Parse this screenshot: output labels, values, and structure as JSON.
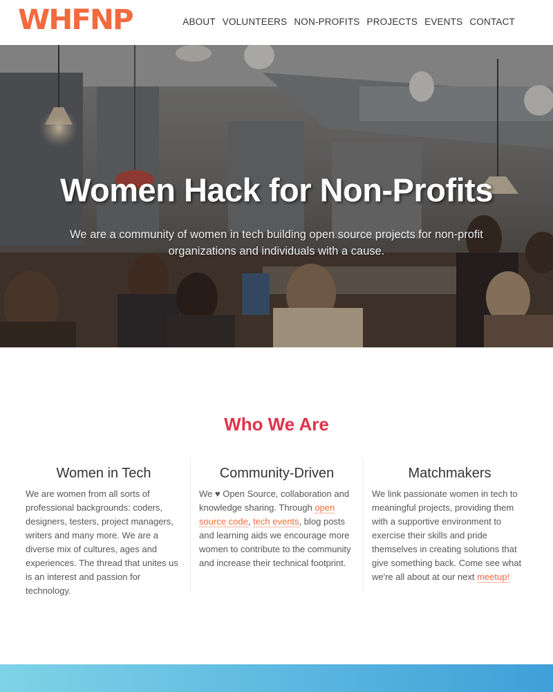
{
  "header": {
    "logo_text": "WHFNP",
    "nav": [
      "ABOUT",
      "VOLUNTEERS",
      "NON-PROFITS",
      "PROJECTS",
      "EVENTS",
      "CONTACT"
    ]
  },
  "hero": {
    "title": "Women Hack for Non-Profits",
    "subtitle": "We are a community of women in tech building open source projects for non-profit organizations and individuals with a cause."
  },
  "who": {
    "title": "Who We Are",
    "columns": [
      {
        "heading": "Women in Tech",
        "text": "We are women from all sorts of professional backgrounds: coders, designers, testers, project managers, writers and many more. We are a diverse mix of cultures, ages and experiences. The thread that unites us is an interest and passion for technology."
      },
      {
        "heading": "Community-Driven",
        "text_a": "We ♥ Open Source, collaboration and knowledge sharing. Through ",
        "link_1": "open source code",
        "text_b": ", ",
        "link_2": "tech events",
        "text_c": ", blog posts and learning aids we encourage more women to contribute to the community and increase their technical footprint."
      },
      {
        "heading": "Matchmakers",
        "text_a": "We link passionate women in tech to meaningful projects, providing them with a supportive environment to exercise their skills and pride themselves in creating solutions that give something back. Come see what we're all about at our next ",
        "link_1": "meetup!"
      }
    ]
  },
  "colors": {
    "brand_orange": "#f26a3d",
    "section_red": "#e0324b",
    "band_blue": "#5bb7e0"
  }
}
